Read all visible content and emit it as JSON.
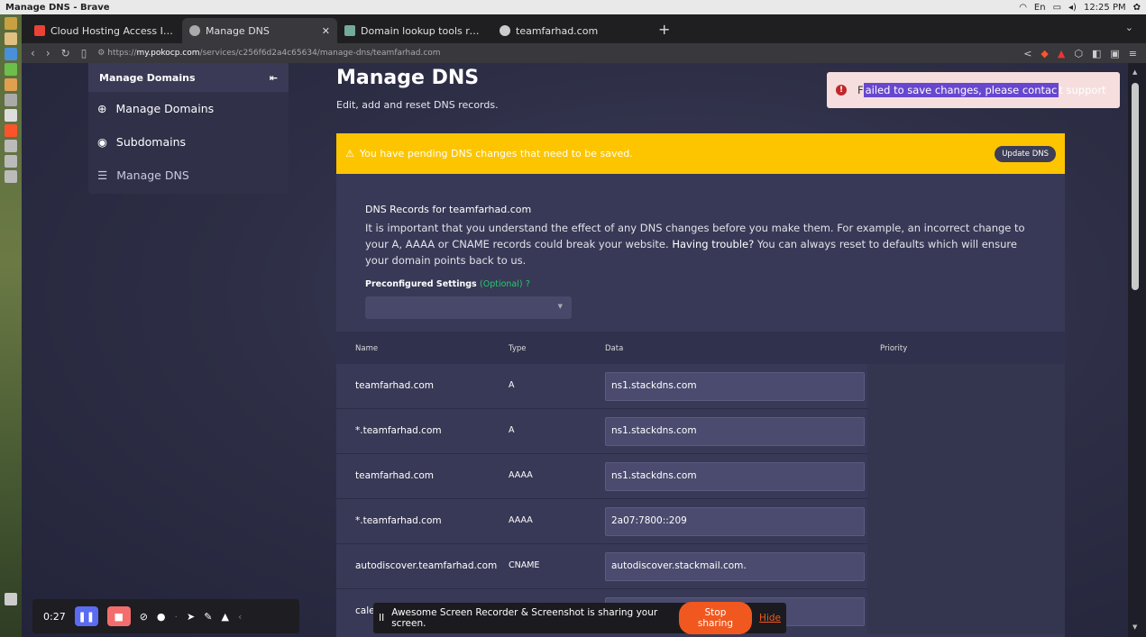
{
  "os_bar": {
    "window_title": "Manage DNS - Brave",
    "time": "12:25 PM",
    "keyboard": "En"
  },
  "browser": {
    "tabs": [
      {
        "title": "Cloud Hosting Access Inform",
        "icon": "gmail-icon",
        "active": false
      },
      {
        "title": "Manage DNS",
        "icon": "globe-icon",
        "active": true
      },
      {
        "title": "Domain lookup tools recomm",
        "icon": "chatgpt-icon",
        "active": false
      },
      {
        "title": "teamfarhad.com",
        "icon": "globe-icon",
        "active": false
      }
    ],
    "new_tab": "+",
    "url_prefix": "https://",
    "url_host": "my.pokocp.com",
    "url_path": "/services/c256f6d2a4c65634/manage-dns/teamfarhad.com"
  },
  "sidebar": {
    "header": "Manage Domains",
    "collapse_icon": "⇤",
    "items": [
      {
        "label": "Manage Domains",
        "icon": "globe-icon"
      },
      {
        "label": "Subdomains",
        "icon": "dot-circle-icon"
      },
      {
        "label": "Manage DNS",
        "icon": "list-icon"
      }
    ]
  },
  "page": {
    "title": "Manage DNS",
    "subtitle": "Edit, add and reset DNS records."
  },
  "toast": {
    "icon": "!",
    "prefix": "F",
    "highlighted": "ailed to save changes, please contac",
    "rest": "t support"
  },
  "alert": {
    "icon": "⚠",
    "text": "You have pending DNS changes that need to be saved.",
    "button": "Update DNS"
  },
  "panel": {
    "title": "DNS Records for teamfarhad.com",
    "text_1": "It is important that you understand the effect of any DNS changes before you make them. For example, an incorrect change to your A, AAAA or CNAME records could break your website. ",
    "text_bold": "Having trouble?",
    "text_2": " You can always reset to defaults which will ensure your domain points back to us.",
    "preconfigured_label": "Preconfigured Settings",
    "preconfigured_optional": "(Optional)",
    "preconfigured_help_icon": "?"
  },
  "table": {
    "columns": [
      "Name",
      "Type",
      "Data",
      "Priority"
    ],
    "rows": [
      {
        "name": "teamfarhad.com",
        "type": "A",
        "data": "ns1.stackdns.com"
      },
      {
        "name": "*.teamfarhad.com",
        "type": "A",
        "data": "ns1.stackdns.com"
      },
      {
        "name": "teamfarhad.com",
        "type": "AAAA",
        "data": "ns1.stackdns.com"
      },
      {
        "name": "*.teamfarhad.com",
        "type": "AAAA",
        "data": "2a07:7800::209"
      },
      {
        "name": "autodiscover.teamfarhad.com",
        "type": "CNAME",
        "data": "autodiscover.stackmail.com."
      }
    ],
    "partial_row_name": "cale"
  },
  "recorder": {
    "time": "0:27"
  },
  "share_bar": {
    "pause_icon": "II",
    "text": "Awesome Screen Recorder & Screenshot is sharing your screen.",
    "stop_label": "Stop sharing",
    "hide_label": "Hide"
  }
}
